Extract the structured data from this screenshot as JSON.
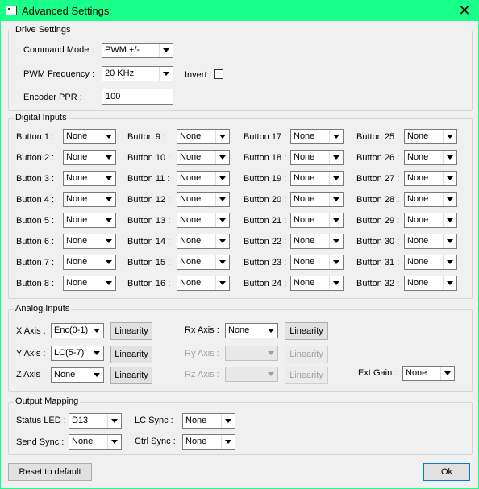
{
  "window": {
    "title": "Advanced Settings",
    "close_glyph": "✕"
  },
  "drive": {
    "group_label": "Drive Settings",
    "command_mode_label": "Command Mode :",
    "command_mode_value": "PWM +/-",
    "pwm_frequency_label": "PWM Frequency :",
    "pwm_frequency_value": "20 KHz",
    "invert_label": "Invert",
    "invert_checked": false,
    "encoder_ppr_label": "Encoder PPR :",
    "encoder_ppr_value": "100"
  },
  "digital": {
    "group_label": "Digital Inputs",
    "buttons": [
      {
        "label": "Button  1 :",
        "value": "None"
      },
      {
        "label": "Button  2 :",
        "value": "None"
      },
      {
        "label": "Button  3 :",
        "value": "None"
      },
      {
        "label": "Button  4 :",
        "value": "None"
      },
      {
        "label": "Button  5 :",
        "value": "None"
      },
      {
        "label": "Button  6 :",
        "value": "None"
      },
      {
        "label": "Button  7 :",
        "value": "None"
      },
      {
        "label": "Button  8 :",
        "value": "None"
      },
      {
        "label": "Button  9 :",
        "value": "None"
      },
      {
        "label": "Button 10 :",
        "value": "None"
      },
      {
        "label": "Button 11 :",
        "value": "None"
      },
      {
        "label": "Button 12 :",
        "value": "None"
      },
      {
        "label": "Button 13 :",
        "value": "None"
      },
      {
        "label": "Button 14 :",
        "value": "None"
      },
      {
        "label": "Button 15 :",
        "value": "None"
      },
      {
        "label": "Button 16 :",
        "value": "None"
      },
      {
        "label": "Button 17 :",
        "value": "None"
      },
      {
        "label": "Button 18 :",
        "value": "None"
      },
      {
        "label": "Button 19 :",
        "value": "None"
      },
      {
        "label": "Button 20 :",
        "value": "None"
      },
      {
        "label": "Button 21 :",
        "value": "None"
      },
      {
        "label": "Button 22 :",
        "value": "None"
      },
      {
        "label": "Button 23 :",
        "value": "None"
      },
      {
        "label": "Button 24 :",
        "value": "None"
      },
      {
        "label": "Button 25 :",
        "value": "None"
      },
      {
        "label": "Button 26 :",
        "value": "None"
      },
      {
        "label": "Button 27 :",
        "value": "None"
      },
      {
        "label": "Button 28 :",
        "value": "None"
      },
      {
        "label": "Button 29 :",
        "value": "None"
      },
      {
        "label": "Button 30 :",
        "value": "None"
      },
      {
        "label": "Button 31 :",
        "value": "None"
      },
      {
        "label": "Button 32 :",
        "value": "None"
      }
    ]
  },
  "analog": {
    "group_label": "Analog Inputs",
    "x_axis_label": "X Axis :",
    "x_axis_value": "Enc(0-1)",
    "y_axis_label": "Y Axis :",
    "y_axis_value": "LC(5-7)",
    "z_axis_label": "Z Axis :",
    "z_axis_value": "None",
    "rx_axis_label": "Rx Axis :",
    "rx_axis_value": "None",
    "ry_axis_label": "Ry Axis :",
    "ry_axis_value": "",
    "rz_axis_label": "Rz Axis :",
    "rz_axis_value": "",
    "linearity_label": "Linearity",
    "ext_gain_label": "Ext Gain :",
    "ext_gain_value": "None"
  },
  "output": {
    "group_label": "Output Mapping",
    "status_led_label": "Status LED :",
    "status_led_value": "D13",
    "send_sync_label": "Send Sync :",
    "send_sync_value": "None",
    "lc_sync_label": "LC Sync :",
    "lc_sync_value": "None",
    "ctrl_sync_label": "Ctrl Sync :",
    "ctrl_sync_value": "None"
  },
  "footer": {
    "reset_label": "Reset to default",
    "ok_label": "Ok"
  }
}
